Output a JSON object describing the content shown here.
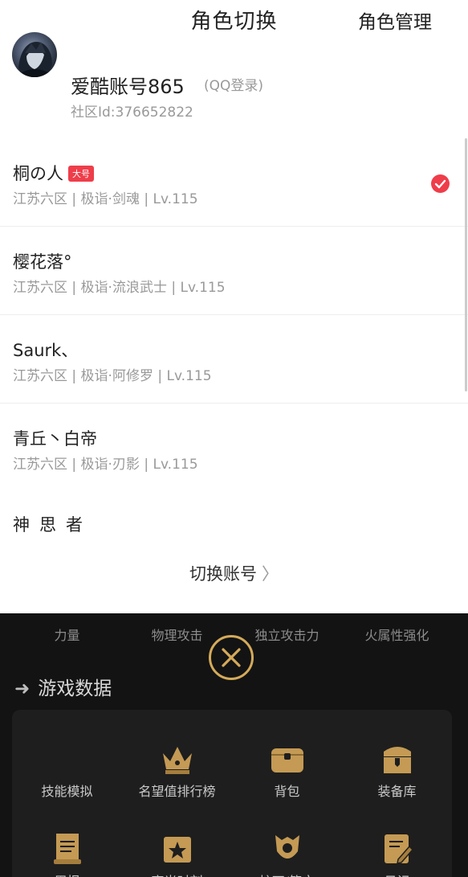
{
  "header": {
    "title": "角色切换",
    "manage": "角色管理"
  },
  "account": {
    "name": "爱酷账号865",
    "login_type": "(QQ登录)",
    "community_id": "社区Id:376652822"
  },
  "roles": [
    {
      "name": "桐の人",
      "badge": "大号",
      "info": "江苏六区 | 极诣·剑魂 | Lv.115",
      "selected": true
    },
    {
      "name": "樱花落°",
      "info": "江苏六区 | 极诣·流浪武士 | Lv.115"
    },
    {
      "name": "Saurk、",
      "info": "江苏六区 | 极诣·阿修罗 | Lv.115"
    },
    {
      "name": "青丘丶白帝",
      "info": "江苏六区 | 极诣·刃影 | Lv.115"
    },
    {
      "name": "神思者"
    }
  ],
  "switch_account": {
    "label": "切换账号",
    "chevron": "〉"
  },
  "stats": [
    "力量",
    "物理攻击",
    "独立攻击力",
    "火属性强化"
  ],
  "section": {
    "title": "游戏数据"
  },
  "tiles": [
    {
      "label": "技能模拟",
      "icon": "none"
    },
    {
      "label": "名望值排行榜",
      "icon": "crown-icon"
    },
    {
      "label": "背包",
      "icon": "bag-icon"
    },
    {
      "label": "装备库",
      "icon": "treasure-chest-icon"
    },
    {
      "label": "周报",
      "icon": "scroll-icon"
    },
    {
      "label": "高光时刻",
      "icon": "star-box-icon"
    },
    {
      "label": "护石/符文",
      "icon": "shield-crest-icon"
    },
    {
      "label": "日记",
      "icon": "diary-icon"
    }
  ],
  "colors": {
    "accent_red": "#ef3d4a",
    "gold": "#d4aa5a",
    "dark_bg": "#131313",
    "card_bg": "#1e1e1e"
  }
}
